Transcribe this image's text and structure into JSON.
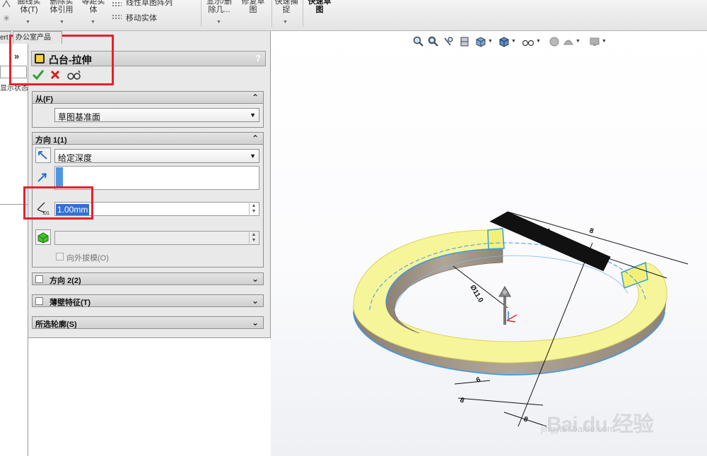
{
  "ribbon": {
    "buttons": [
      {
        "label": "曲线实\n体(T)"
      },
      {
        "label": "删除实\n体引用"
      },
      {
        "label": "等距实\n体"
      },
      {
        "label": "线性草图阵列"
      },
      {
        "label": "移动实体"
      },
      {
        "label": "显示/删\n除几..."
      },
      {
        "label": "修复草\n图"
      },
      {
        "label": "快速捕\n捉"
      },
      {
        "label": "快速草\n图"
      }
    ]
  },
  "left_strip": {
    "tab_label_1": "ert",
    "tab_label_2": "办公室产品",
    "collapse": "»",
    "status_text": "显示状态"
  },
  "property_manager": {
    "title": "凸台-拉伸",
    "help": "?",
    "ok_icon": "checkmark-icon",
    "cancel_icon": "x-icon",
    "preview_icon": "glasses-icon",
    "from": {
      "header": "从(F)",
      "combo_value": "草图基准面"
    },
    "direction1": {
      "header": "方向 1(1)",
      "end_condition": "给定深度",
      "depth_value": "1.00mm",
      "draft_outward_label": "向外拔模(O)"
    },
    "direction2": {
      "header": "方向 2(2)",
      "checked": false
    },
    "thin_feature": {
      "header": "薄壁特征(T)",
      "checked": false
    },
    "selected_contours": {
      "header": "所选轮廓(S)"
    }
  },
  "colors": {
    "callout": "#e4212b",
    "ring_fill": "#f7f59a",
    "ring_wall": "#9d9182",
    "edge_blue": "#3b9ae8",
    "accent": "#3170d6"
  },
  "model": {
    "dimensions": [
      "4",
      "8",
      "Ø11.0",
      "6",
      "8",
      "8"
    ]
  },
  "watermark": {
    "line1": "Bai du 经验",
    "line2": "jingyan.baidu.com"
  }
}
